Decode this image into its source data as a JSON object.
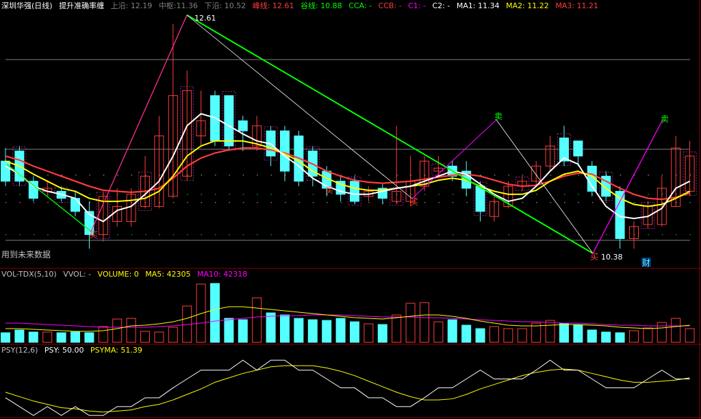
{
  "colors": {
    "up": "#ff3c3c",
    "down": "#54ffff",
    "white": "#ffffff",
    "yellow": "#ffff00",
    "magenta": "#ff00ff",
    "green": "#00ff00",
    "grey": "#808080",
    "pink": "#ff2d8f"
  },
  "main": {
    "title": "深圳华强(日线)",
    "indicator": "提升准确率缠",
    "upper_label": "上沿:",
    "upper_value": "12.19",
    "mid_label": "中枢:",
    "mid_value": "11.36",
    "lower_label": "下沿:",
    "lower_value": "10.52",
    "peak_label": "峰线:",
    "peak_value": "12.61",
    "valley_label": "谷线:",
    "valley_value": "10.88",
    "cca": "CCA: -",
    "ccb": "CCB: -",
    "c1": "C1: -",
    "c2": "C2: -",
    "ma1": "MA1: 11.34",
    "ma2": "MA2: 11.22",
    "ma3": "MA3: 11.21",
    "future_note": "用到未来数据",
    "high_price_label": "12.61",
    "low_price_label": "10.38",
    "sell_mark": "卖",
    "buy_mark": "买",
    "fin_mark": "财"
  },
  "vol": {
    "name": "VOL-TDX(5,10)",
    "vvol": "VVOL: -",
    "volume": "VOLUME: 0",
    "ma5": "MA5: 42305",
    "ma10": "MA10: 42318"
  },
  "psy": {
    "name": "PSY(12,6)",
    "psy": "PSY: 50.00",
    "psyma": "PSYMA: 51.39"
  },
  "chart_data": [
    {
      "type": "candlestick",
      "title": "深圳华强(日线)",
      "ylim": [
        10.3,
        12.7
      ],
      "x": [
        1,
        2,
        3,
        4,
        5,
        6,
        7,
        8,
        9,
        10,
        11,
        12,
        13,
        14,
        15,
        16,
        17,
        18,
        19,
        20,
        21,
        22,
        23,
        24,
        25,
        26,
        27,
        28,
        29,
        30,
        31,
        32,
        33,
        34,
        35,
        36,
        37,
        38,
        39,
        40,
        41,
        42,
        43,
        44,
        45,
        46,
        47,
        48,
        49,
        50
      ],
      "open": [
        11.25,
        11.35,
        11.05,
        10.95,
        10.95,
        10.88,
        10.75,
        10.52,
        10.65,
        10.65,
        10.8,
        10.8,
        10.9,
        11.1,
        11.5,
        11.9,
        11.9,
        11.65,
        11.4,
        11.55,
        11.55,
        11.5,
        11.35,
        11.15,
        11.05,
        11.05,
        10.9,
        10.98,
        10.85,
        10.85,
        11.0,
        11.15,
        11.2,
        11.15,
        11.0,
        10.7,
        10.8,
        11.0,
        11.05,
        11.2,
        11.48,
        11.45,
        11.2,
        11.1,
        10.95,
        10.48,
        10.62,
        10.62,
        10.8,
        10.95
      ],
      "close": [
        11.05,
        11.05,
        10.88,
        10.98,
        10.88,
        10.75,
        10.52,
        10.9,
        10.8,
        10.92,
        11.1,
        11.5,
        11.9,
        11.95,
        11.65,
        11.45,
        11.4,
        11.55,
        11.6,
        11.3,
        11.15,
        11.05,
        11.1,
        10.98,
        10.92,
        10.85,
        10.95,
        10.88,
        10.95,
        11.05,
        11.25,
        11.18,
        11.1,
        10.98,
        10.75,
        10.85,
        11.0,
        11.05,
        11.2,
        11.4,
        11.25,
        11.3,
        10.95,
        10.9,
        10.48,
        10.6,
        10.8,
        10.98,
        11.38,
        11.3
      ],
      "high": [
        11.38,
        11.4,
        11.1,
        11.05,
        11.0,
        10.95,
        10.85,
        10.95,
        10.98,
        10.98,
        11.3,
        11.7,
        12.61,
        12.15,
        11.95,
        11.95,
        11.9,
        11.7,
        11.7,
        11.6,
        11.6,
        11.55,
        11.4,
        11.2,
        11.1,
        11.1,
        11.0,
        11.02,
        11.6,
        11.3,
        11.3,
        11.3,
        11.25,
        11.25,
        11.05,
        10.9,
        11.05,
        11.1,
        11.25,
        11.5,
        11.6,
        11.45,
        11.25,
        11.15,
        11.0,
        10.65,
        10.85,
        11.1,
        11.5,
        11.45
      ],
      "low": [
        11.0,
        11.0,
        10.85,
        10.9,
        10.85,
        10.7,
        10.38,
        10.45,
        10.6,
        10.6,
        10.78,
        10.78,
        10.88,
        11.05,
        11.4,
        11.4,
        11.35,
        11.35,
        11.35,
        11.2,
        11.05,
        11.0,
        11.0,
        10.9,
        10.85,
        10.82,
        10.85,
        10.82,
        10.82,
        10.8,
        10.95,
        11.1,
        11.05,
        10.9,
        10.65,
        10.65,
        10.78,
        10.95,
        11.0,
        11.15,
        11.2,
        11.2,
        10.9,
        10.85,
        10.38,
        10.38,
        10.58,
        10.6,
        10.8,
        10.9
      ],
      "ma1": [
        11.2,
        11.12,
        11.0,
        10.95,
        10.92,
        10.88,
        10.72,
        10.65,
        10.76,
        10.8,
        10.92,
        11.05,
        11.3,
        11.6,
        11.72,
        11.68,
        11.6,
        11.52,
        11.45,
        11.42,
        11.3,
        11.2,
        11.08,
        11.0,
        10.95,
        10.92,
        10.92,
        10.95,
        10.98,
        11.0,
        11.05,
        11.1,
        11.15,
        11.12,
        11.02,
        10.92,
        10.85,
        10.88,
        11.0,
        11.15,
        11.28,
        11.22,
        11.0,
        10.8,
        10.7,
        10.68,
        10.7,
        10.78,
        10.98,
        11.05
      ],
      "ma2": [
        11.25,
        11.2,
        11.12,
        11.05,
        10.98,
        10.95,
        10.88,
        10.85,
        10.85,
        10.86,
        10.88,
        10.95,
        11.1,
        11.3,
        11.4,
        11.45,
        11.45,
        11.45,
        11.42,
        11.38,
        11.32,
        11.25,
        11.15,
        11.08,
        11.02,
        10.98,
        10.96,
        10.96,
        10.98,
        11.0,
        11.02,
        11.06,
        11.08,
        11.06,
        11.0,
        10.95,
        10.92,
        10.92,
        10.96,
        11.05,
        11.12,
        11.15,
        11.1,
        10.98,
        10.88,
        10.82,
        10.8,
        10.82,
        10.88,
        10.95
      ],
      "ma3": [
        11.3,
        11.26,
        11.2,
        11.15,
        11.1,
        11.05,
        11.0,
        10.96,
        10.95,
        10.94,
        10.95,
        10.98,
        11.08,
        11.2,
        11.28,
        11.33,
        11.36,
        11.38,
        11.38,
        11.36,
        11.33,
        11.28,
        11.22,
        11.15,
        11.1,
        11.06,
        11.04,
        11.03,
        11.04,
        11.05,
        11.07,
        11.09,
        11.11,
        11.12,
        11.1,
        11.06,
        11.02,
        11.0,
        11.01,
        11.05,
        11.1,
        11.13,
        11.12,
        11.05,
        10.98,
        10.92,
        10.88,
        10.87,
        10.89,
        10.93
      ]
    },
    {
      "type": "bar",
      "title": "VOL-TDX(5,10)",
      "values": [
        14000,
        18000,
        15000,
        15000,
        14000,
        15000,
        14000,
        23000,
        34000,
        35000,
        16000,
        15000,
        22000,
        53000,
        85000,
        86000,
        35000,
        33000,
        65000,
        43000,
        40000,
        35000,
        33000,
        32000,
        35000,
        30000,
        27000,
        26000,
        40000,
        57000,
        58000,
        30000,
        33000,
        25000,
        20000,
        23000,
        20000,
        20000,
        28000,
        32000,
        28000,
        25000,
        18000,
        15000,
        14000,
        17000,
        21000,
        29000,
        35000,
        20000
      ],
      "ma5": [
        20000,
        20000,
        19000,
        18000,
        17000,
        16000,
        16000,
        17000,
        20000,
        24000,
        25000,
        27000,
        30000,
        35000,
        42000,
        48000,
        52000,
        52000,
        50000,
        48000,
        46000,
        44000,
        42000,
        40000,
        38000,
        36000,
        35000,
        34000,
        36000,
        38000,
        40000,
        40000,
        38000,
        35000,
        31000,
        28000,
        25000,
        24000,
        24000,
        25000,
        26000,
        26000,
        25000,
        24000,
        22000,
        21000,
        20000,
        21000,
        23000,
        25000
      ],
      "ma10": [
        28000,
        28000,
        27000,
        26000,
        25000,
        24000,
        23000,
        22000,
        22000,
        22000,
        22000,
        23000,
        24000,
        26000,
        28000,
        31000,
        33000,
        35000,
        37000,
        38000,
        39000,
        39000,
        40000,
        40000,
        40000,
        39000,
        38000,
        37000,
        37000,
        37000,
        36000,
        36000,
        35000,
        34000,
        33000,
        32000,
        31000,
        30000,
        30000,
        29000,
        28000,
        28000,
        27000,
        26000,
        25000,
        25000,
        24000,
        24000,
        24000,
        24000
      ]
    },
    {
      "type": "line",
      "title": "PSY(12,6)",
      "x": [
        1,
        2,
        3,
        4,
        5,
        6,
        7,
        8,
        9,
        10,
        11,
        12,
        13,
        14,
        15,
        16,
        17,
        18,
        19,
        20,
        21,
        22,
        23,
        24,
        25,
        26,
        27,
        28,
        29,
        30,
        31,
        32,
        33,
        34,
        35,
        36,
        37,
        38,
        39,
        40,
        41,
        42,
        43,
        44,
        45,
        46,
        47,
        48,
        49,
        50
      ],
      "series": [
        {
          "name": "PSY",
          "values": [
            33,
            25,
            17,
            25,
            17,
            25,
            17,
            17,
            25,
            25,
            33,
            33,
            42,
            50,
            58,
            58,
            58,
            67,
            58,
            67,
            67,
            58,
            58,
            50,
            42,
            42,
            33,
            33,
            25,
            25,
            33,
            42,
            42,
            50,
            58,
            50,
            50,
            50,
            58,
            67,
            58,
            58,
            50,
            42,
            42,
            42,
            50,
            58,
            50,
            50
          ]
        },
        {
          "name": "PSYMA",
          "values": [
            38,
            34,
            30,
            27,
            24,
            23,
            21,
            20,
            21,
            22,
            25,
            27,
            31,
            36,
            41,
            47,
            51,
            55,
            58,
            61,
            62,
            62,
            62,
            60,
            57,
            53,
            48,
            43,
            38,
            34,
            31,
            31,
            32,
            36,
            41,
            45,
            49,
            53,
            56,
            58,
            59,
            58,
            55,
            52,
            49,
            47,
            47,
            48,
            49,
            51
          ]
        }
      ]
    }
  ]
}
